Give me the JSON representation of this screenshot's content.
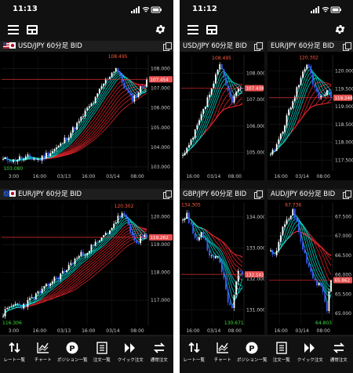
{
  "left_phone": {
    "time": "11:13",
    "charts": [
      {
        "id": "usdjpy-left",
        "title": "USD/JPY 60分足 BID",
        "has_flags": true,
        "high_label": "108.495",
        "low_label": "103.080",
        "price_tag": "107.454",
        "y_ticks": [
          "108.000",
          "107.000",
          "106.000",
          "105.000",
          "104.000",
          "103.000"
        ],
        "x_ticks": [
          "3:00",
          "16:00",
          "03/13",
          "16:00",
          "03/14",
          "08:00"
        ],
        "chart_data": {
          "type": "candlestick",
          "ylim": [
            102.8,
            108.7
          ],
          "low": 103.08,
          "high": 108.495,
          "last": 107.454
        }
      },
      {
        "id": "eurjpy-left",
        "title": "EUR/JPY 60分足 BID",
        "has_flags": true,
        "high_label": "120.302",
        "low_label": "116.306",
        "price_tag": "119.262",
        "y_ticks": [
          "120.000",
          "119.000",
          "118.000",
          "117.000"
        ],
        "x_ticks": [
          "3:00",
          "16:00",
          "03/13",
          "16:00",
          "03/14",
          "08:00"
        ],
        "chart_data": {
          "type": "candlestick",
          "ylim": [
            116.1,
            120.5
          ],
          "low": 116.306,
          "high": 120.302,
          "last": 119.262
        }
      }
    ]
  },
  "right_phone": {
    "time": "11:12",
    "charts": [
      {
        "id": "usdjpy-right",
        "title": "USD/JPY 60分足 BID",
        "has_flags": false,
        "high_label": "108.495",
        "low_label": "",
        "price_tag": "107.438",
        "y_ticks": [
          "108.000",
          "107.000",
          "106.000",
          "105.000"
        ],
        "x_ticks": [
          "16:00",
          "03/14",
          "08:00"
        ],
        "chart_data": {
          "type": "candlestick",
          "ylim": [
            104.3,
            108.7
          ],
          "high": 108.495,
          "last": 107.438
        }
      },
      {
        "id": "eurjpy-right",
        "title": "EUR/JPY 60分足 BID",
        "has_flags": false,
        "high_label": "120.302",
        "low_label": "",
        "price_tag": "119.248",
        "y_ticks": [
          "120.000",
          "119.500",
          "119.000",
          "118.500",
          "118.000",
          "117.500"
        ],
        "x_ticks": [
          "16:00",
          "03/14",
          "08:00"
        ],
        "chart_data": {
          "type": "candlestick",
          "ylim": [
            117.2,
            120.45
          ],
          "high": 120.302,
          "last": 119.248
        }
      },
      {
        "id": "gbpjpy-right",
        "title": "GBP/JPY 60分足 BID",
        "has_flags": false,
        "high_label": "134.305",
        "low_label": "130.671",
        "price_tag": "132.143",
        "y_ticks": [
          "134.000",
          "133.000",
          "132.000",
          "131.000"
        ],
        "x_ticks": [
          "16:00",
          "03/14",
          "08:00"
        ],
        "chart_data": {
          "type": "candlestick",
          "ylim": [
            130.5,
            134.45
          ],
          "high": 134.305,
          "low": 130.671,
          "last": 132.143
        }
      },
      {
        "id": "audjpy-right",
        "title": "AUD/JPY 60分足 BID",
        "has_flags": false,
        "high_label": "67.736",
        "low_label": "64.803",
        "price_tag": "65.862",
        "y_ticks": [
          "67.500",
          "67.000",
          "66.500",
          "66.000",
          "65.500",
          "65.000"
        ],
        "x_ticks": [
          "16:00",
          "03/14",
          "08:00"
        ],
        "chart_data": {
          "type": "candlestick",
          "ylim": [
            64.7,
            67.85
          ],
          "high": 67.736,
          "low": 64.803,
          "last": 65.862
        }
      }
    ]
  },
  "nav": [
    {
      "label": "レート一覧",
      "icon": "rate-list-icon"
    },
    {
      "label": "チャート",
      "icon": "chart-icon"
    },
    {
      "label": "ポジション一覧",
      "icon": "position-icon"
    },
    {
      "label": "注文一覧",
      "icon": "order-list-icon"
    },
    {
      "label": "クイック注文",
      "icon": "quick-order-icon"
    },
    {
      "label": "通常注文",
      "icon": "normal-order-icon"
    }
  ],
  "colors": {
    "background": "#000000",
    "up_candle": "#ffffff",
    "down_candle": "#3d5cff",
    "ma_fast": "#00e5d8",
    "ma_slow": "#e0242b",
    "price_line": "#e03030",
    "price_tag": "#e85050",
    "high_label": "#ff5a3c",
    "low_label": "#3cdc3c"
  }
}
